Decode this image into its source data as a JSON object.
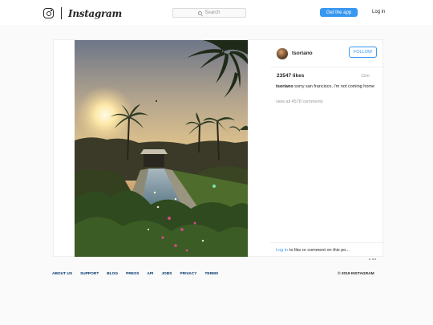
{
  "header": {
    "wordmark": "Instagram",
    "search_placeholder": "Search",
    "get_app_label": "Get the app",
    "login_label": "Log in"
  },
  "post": {
    "username": "tsoriano",
    "follow_label": "FOLLOW",
    "likes": "23547 likes",
    "time": "12m",
    "caption_user": "tsoriano",
    "caption_text": "sorry san francisco, i'm not coming home",
    "view_all": "view all 4578 comments",
    "comment_login": "Log in",
    "comment_prompt": "to like or comment on this po..."
  },
  "footer": {
    "links": [
      "ABOUT US",
      "SUPPORT",
      "BLOG",
      "PRESS",
      "API",
      "JOBS",
      "PRIVACY",
      "TERMS"
    ],
    "copyright": "© 2019 INSTAGRAM"
  },
  "colors": {
    "accent": "#3897f0",
    "footer_link": "#003569",
    "background": "#fafafa"
  }
}
